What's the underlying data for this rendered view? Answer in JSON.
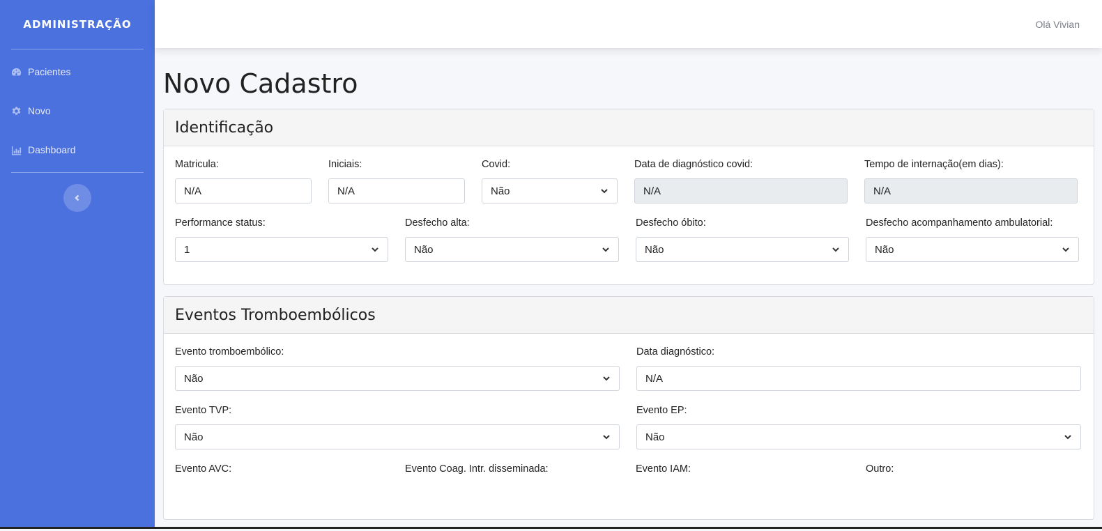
{
  "sidebar": {
    "brand": "ADMINISTRAÇÃO",
    "items": [
      {
        "label": "Pacientes",
        "icon": "dashboard-gauge-icon"
      },
      {
        "label": "Novo",
        "icon": "gear-icon"
      },
      {
        "label": "Dashboard",
        "icon": "chart-icon"
      }
    ],
    "toggle_icon": "chevron-left-icon"
  },
  "topbar": {
    "greeting": "Olá Vivian"
  },
  "page": {
    "title": "Novo Cadastro"
  },
  "identificacao": {
    "header": "Identificação",
    "matricula": {
      "label": "Matricula:",
      "value": "N/A"
    },
    "iniciais": {
      "label": "Iniciais:",
      "value": "N/A"
    },
    "covid": {
      "label": "Covid:",
      "value": "Não"
    },
    "data_covid": {
      "label": "Data de diagnóstico covid:",
      "value": "N/A"
    },
    "tempo_internacao": {
      "label": "Tempo de internação(em dias):",
      "value": "N/A"
    },
    "performance": {
      "label": "Performance status:",
      "value": "1"
    },
    "desfecho_alta": {
      "label": "Desfecho alta:",
      "value": "Não"
    },
    "desfecho_obito": {
      "label": "Desfecho óbito:",
      "value": "Não"
    },
    "desfecho_ambulatorial": {
      "label": "Desfecho acompanhamento ambulatorial:",
      "value": "Não"
    }
  },
  "eventos": {
    "header": "Eventos Tromboembólicos",
    "tromboembolico": {
      "label": "Evento tromboembólico:",
      "value": "Não"
    },
    "data_diagnostico": {
      "label": "Data diagnóstico:",
      "value": "N/A"
    },
    "tvp": {
      "label": "Evento TVP:",
      "value": "Não"
    },
    "ep": {
      "label": "Evento EP:",
      "value": "Não"
    },
    "avc": {
      "label": "Evento AVC:"
    },
    "coag": {
      "label": "Evento Coag. Intr. disseminada:"
    },
    "iam": {
      "label": "Evento IAM:"
    },
    "outro": {
      "label": "Outro:"
    }
  }
}
